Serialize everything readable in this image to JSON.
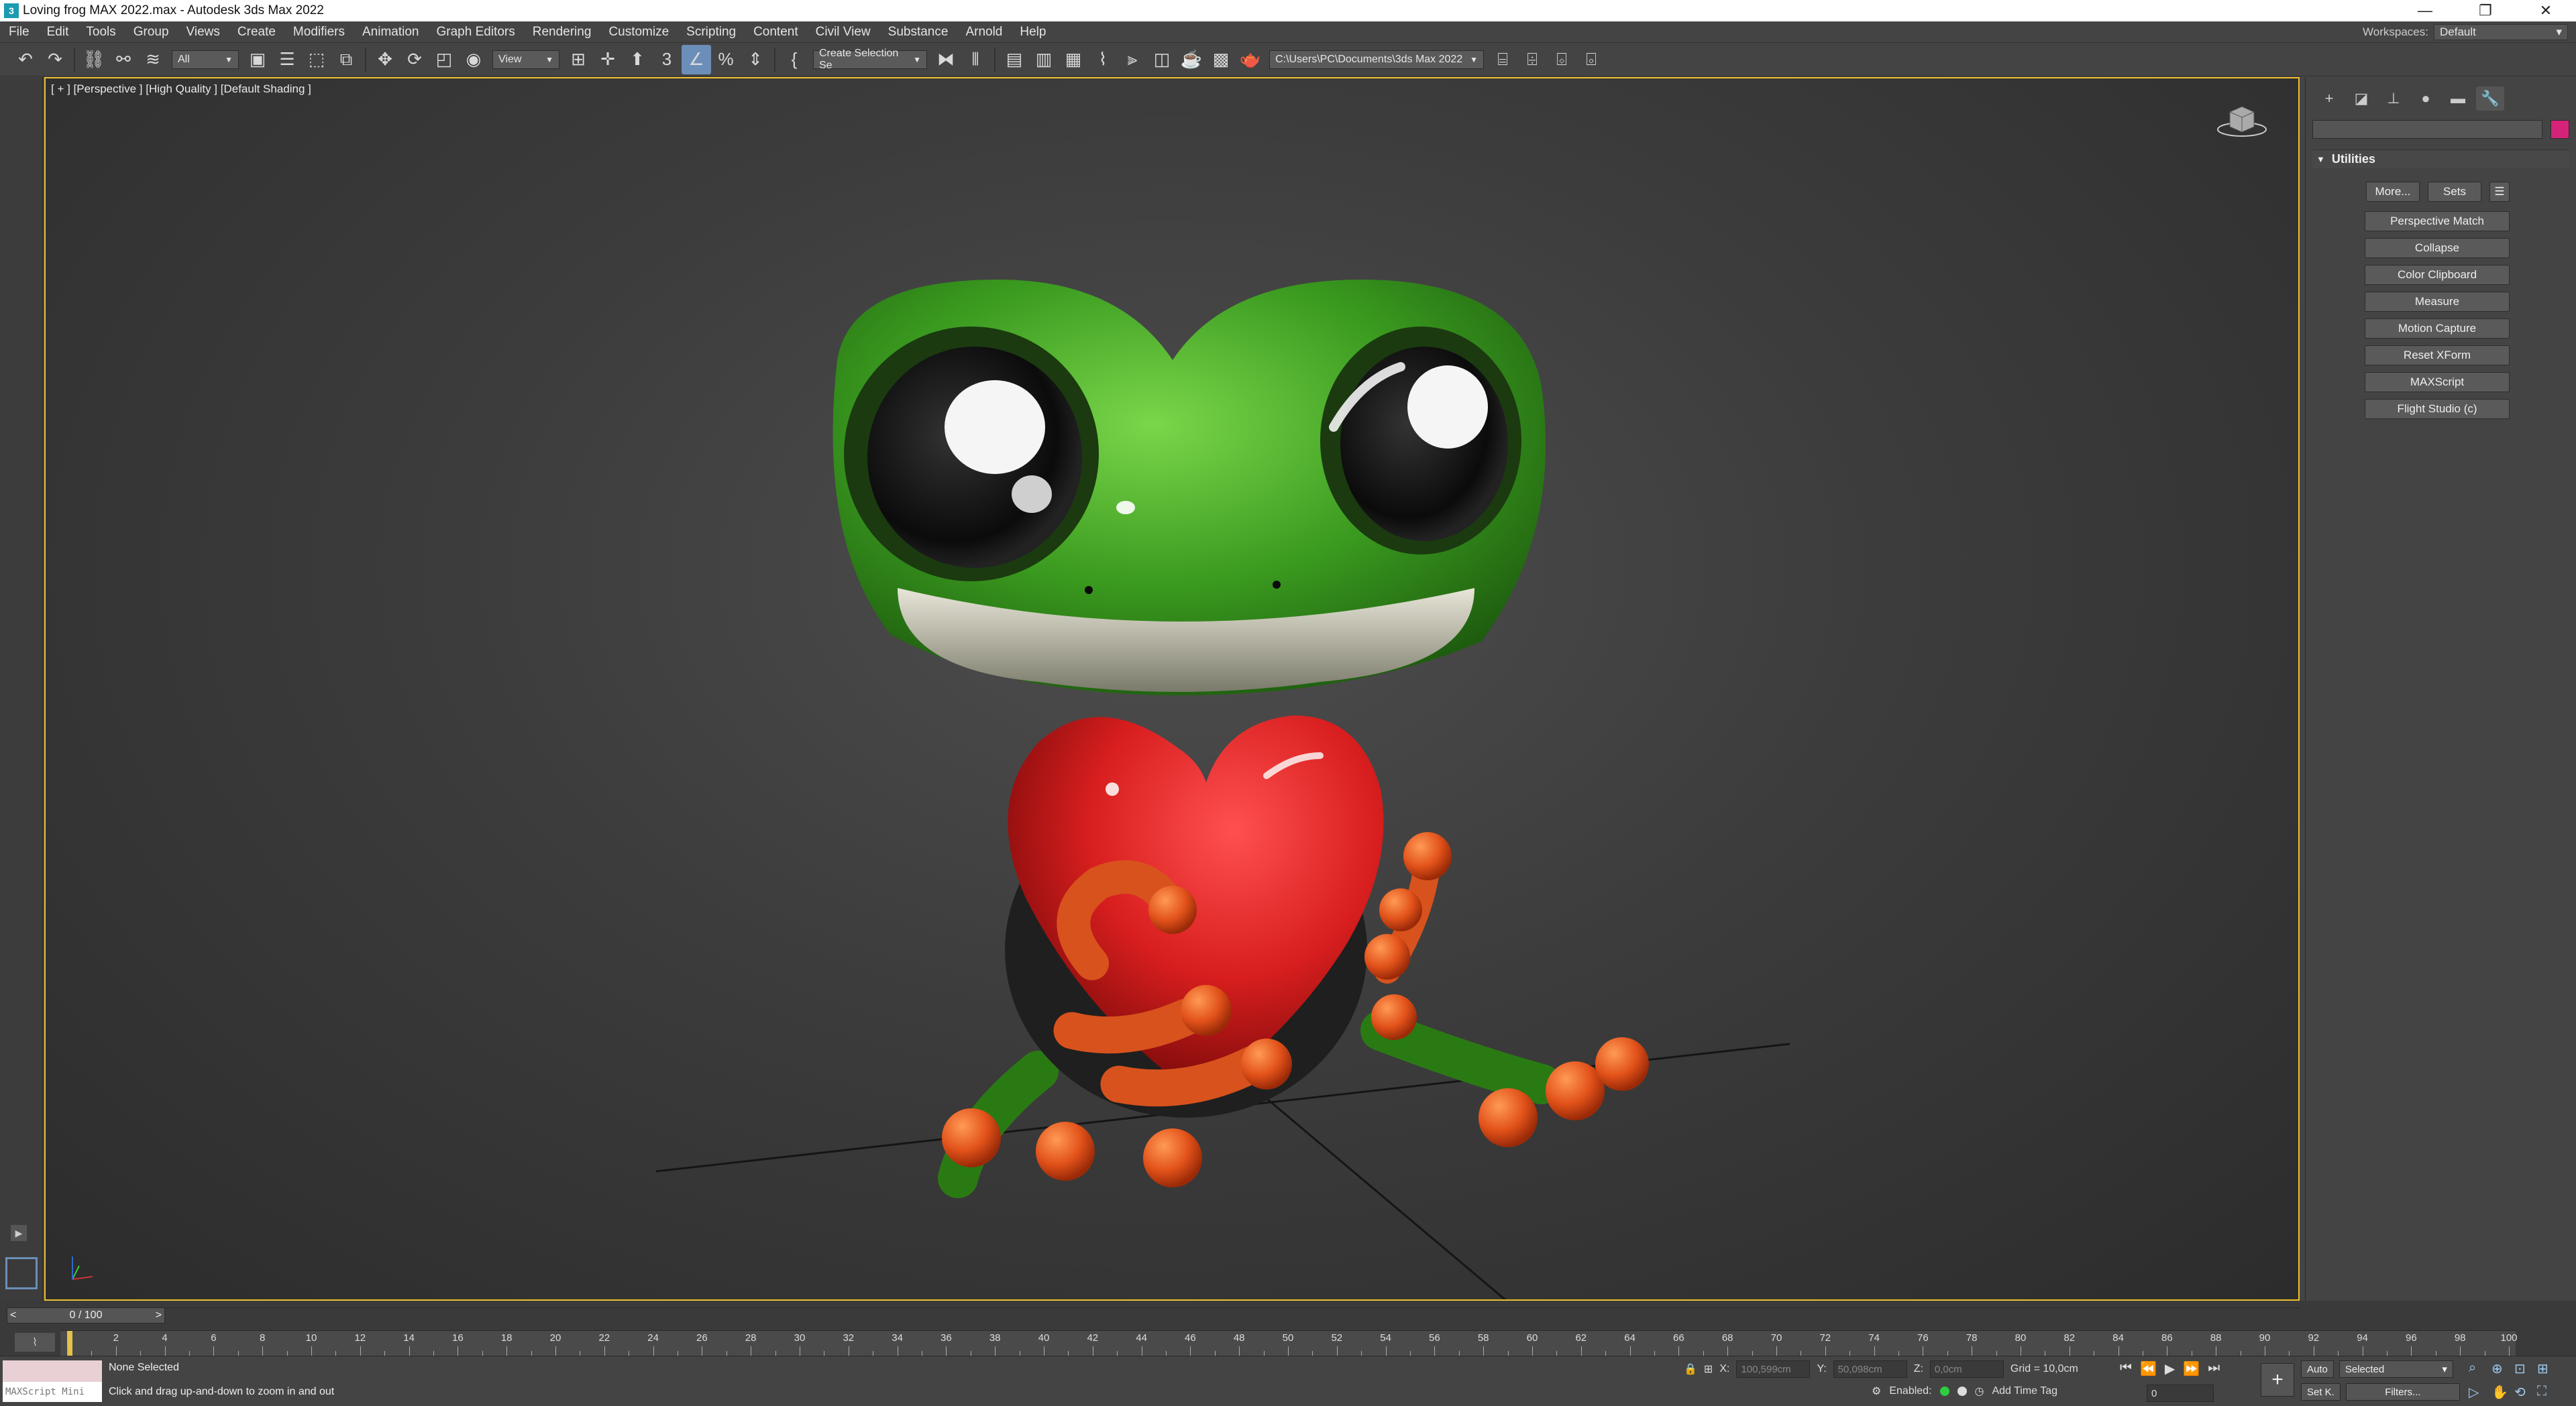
{
  "window": {
    "title": "Loving frog MAX 2022.max - Autodesk 3ds Max 2022",
    "app_icon": "3",
    "controls": [
      "—",
      "❐",
      "✕"
    ]
  },
  "menu": {
    "items": [
      "File",
      "Edit",
      "Tools",
      "Group",
      "Views",
      "Create",
      "Modifiers",
      "Animation",
      "Graph Editors",
      "Rendering",
      "Customize",
      "Scripting",
      "Content",
      "Civil View",
      "Substance",
      "Arnold",
      "Help"
    ],
    "workspaces_label": "Workspaces:",
    "workspace_value": "Default"
  },
  "toolbar": {
    "filter_value": "All",
    "refcoord_value": "View",
    "selection_set_value": "Create Selection Se",
    "project_path": "C:\\Users\\PC\\Documents\\3ds Max 2022",
    "snap_label": "3",
    "percent_label": "%"
  },
  "viewport": {
    "label": "[ + ] [Perspective ] [High Quality ] [Default Shading ]",
    "colors": {
      "frog_green": "#3a9a1f",
      "heart_red": "#d81e1e",
      "finger_orange": "#e2521a",
      "border_active": "#f0c030"
    }
  },
  "command_panel": {
    "tab_icons": [
      "plus-icon",
      "modify-icon",
      "hierarchy-icon",
      "motion-icon",
      "display-icon",
      "utilities-icon"
    ],
    "rollout_title": "Utilities",
    "more_label": "More...",
    "sets_label": "Sets",
    "utilities": [
      "Perspective Match",
      "Collapse",
      "Color Clipboard",
      "Measure",
      "Motion Capture",
      "Reset XForm",
      "MAXScript",
      "Flight Studio (c)"
    ],
    "swatch_color": "#d6237a"
  },
  "timeline": {
    "frame_display": "0 / 100",
    "ticks": [
      "2",
      "4",
      "6",
      "8",
      "10",
      "12",
      "14",
      "16",
      "18",
      "20",
      "22",
      "24",
      "26",
      "28",
      "30",
      "32",
      "34",
      "36",
      "38",
      "40",
      "42",
      "44",
      "46",
      "48",
      "50",
      "52",
      "54",
      "56",
      "58",
      "60",
      "62",
      "64",
      "66",
      "68",
      "70",
      "72",
      "74",
      "76",
      "78",
      "80",
      "82",
      "84",
      "86",
      "88",
      "90",
      "92",
      "94",
      "96",
      "98",
      "100"
    ]
  },
  "status": {
    "maxscript_label": "MAXScript Mini",
    "selection": "None Selected",
    "prompt": "Click and drag up-and-down to zoom in and out",
    "x_label": "X:",
    "x_value": "100,599cm",
    "y_label": "Y:",
    "y_value": "50,098cm",
    "z_label": "Z:",
    "z_value": "0,0cm",
    "grid": "Grid = 10,0cm",
    "enabled_label": "Enabled:",
    "time_tag": "Add Time Tag",
    "frame_value": "0",
    "auto_label": "Auto",
    "setkey_label": "Set K.",
    "selected_value": "Selected",
    "filters_label": "Filters..."
  }
}
